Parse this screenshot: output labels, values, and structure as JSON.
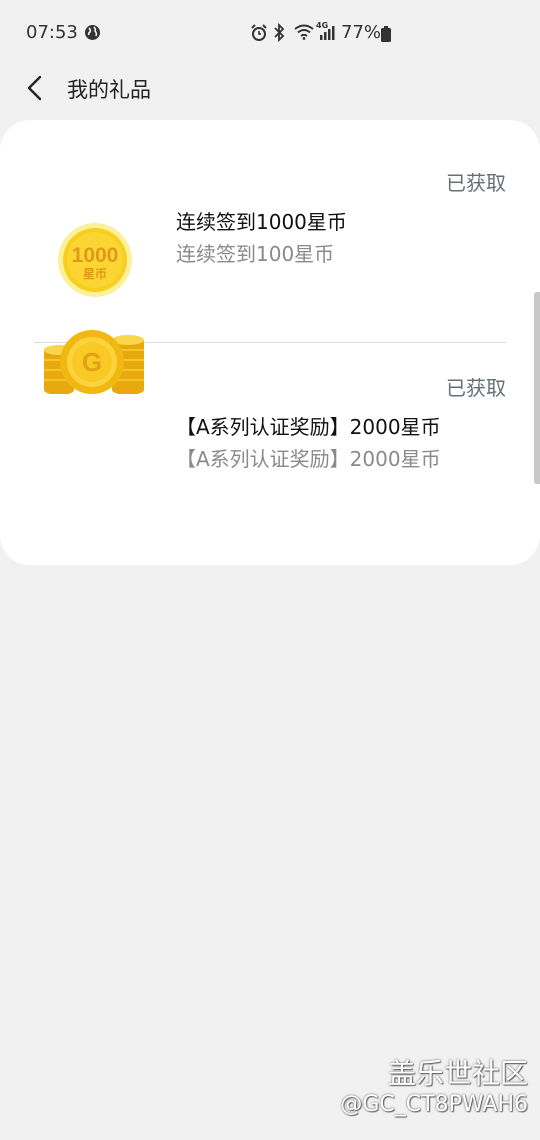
{
  "status_bar": {
    "time": "07:53",
    "network": "4G",
    "battery_percent": "77%",
    "icons": [
      "globe-icon",
      "alarm-icon",
      "bluetooth-icon",
      "wifi-icon",
      "signal-icon",
      "battery-icon"
    ]
  },
  "header": {
    "title": "我的礼品",
    "back_icon": "chevron-left-icon"
  },
  "gifts": [
    {
      "status": "已获取",
      "name": "连续签到1000星币",
      "description": "连续签到100星币",
      "image": {
        "amount": "1000",
        "unit": "星币",
        "icon": "gold-coin-1000"
      }
    },
    {
      "status": "已获取",
      "name": "【A系列认证奖励】2000星币",
      "description": "【A系列认证奖励】2000星币",
      "image": {
        "letter": "G",
        "icon": "gold-coin-stack"
      }
    }
  ],
  "watermark": {
    "title": "盖乐世社区",
    "user": "@GC_CT8PWAH6"
  },
  "colors": {
    "background": "#f1f1f1",
    "card": "#ffffff",
    "status_text": "#667076",
    "secondary_text": "#8a8a8a",
    "coin_gold": "#f5c518",
    "coin_text": "#e0a010"
  }
}
